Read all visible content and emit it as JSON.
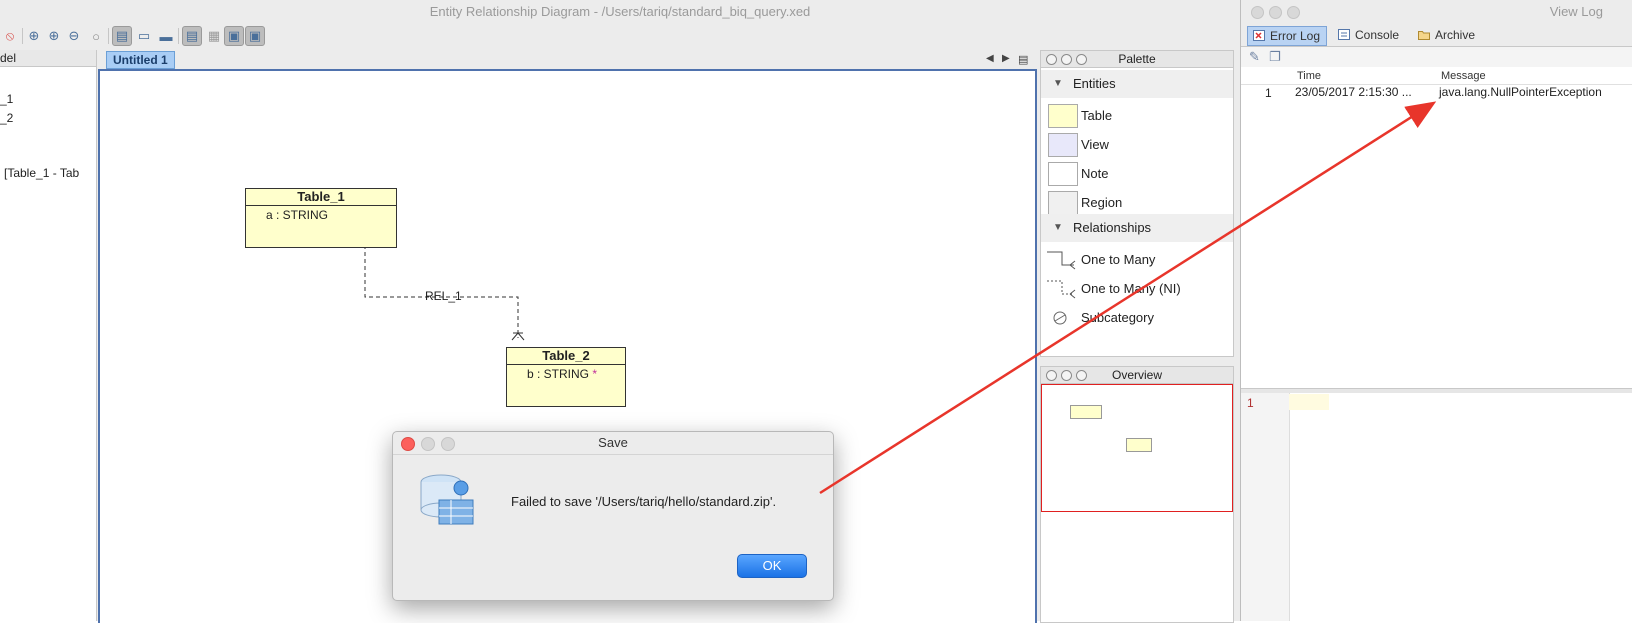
{
  "main_window": {
    "title": "Entity Relationship Diagram - /Users/tariq/standard_biq_query.xed"
  },
  "model_pane": {
    "header": "del",
    "rows": [
      "_1",
      "_2",
      "[Table_1 - Tab"
    ]
  },
  "editor": {
    "tab_label": "Untitled 1",
    "entities": [
      {
        "name": "Table_1",
        "attribute": "a : STRING",
        "pk_marker": ""
      },
      {
        "name": "Table_2",
        "attribute": "b : STRING",
        "pk_marker": "*"
      }
    ],
    "relationship_label": "REL_1"
  },
  "palette": {
    "title": "Palette",
    "sections": [
      {
        "label": "Entities",
        "items": [
          "Table",
          "View",
          "Note",
          "Region"
        ]
      },
      {
        "label": "Relationships",
        "items": [
          "One to Many",
          "One to Many (NI)",
          "Subcategory"
        ]
      }
    ]
  },
  "overview": {
    "title": "Overview"
  },
  "view_log": {
    "title": "View Log",
    "tabs": [
      "Error Log",
      "Console",
      "Archive"
    ],
    "columns": [
      "Time",
      "Message"
    ],
    "rows": [
      {
        "index": "1",
        "time": "23/05/2017 2:15:30 ...",
        "message": "java.lang.NullPointerException"
      }
    ],
    "detail_line_number": "1"
  },
  "save_dialog": {
    "title": "Save",
    "message": "Failed to save '/Users/tariq/hello/standard.zip'.",
    "ok_label": "OK"
  },
  "colors": {
    "canvas_border": "#4f72ad",
    "entity_fill": "#ffffcc",
    "annotation_arrow": "#e8352b",
    "ok_button": "#1a72e6",
    "active_tab": "#a9cdf5"
  }
}
